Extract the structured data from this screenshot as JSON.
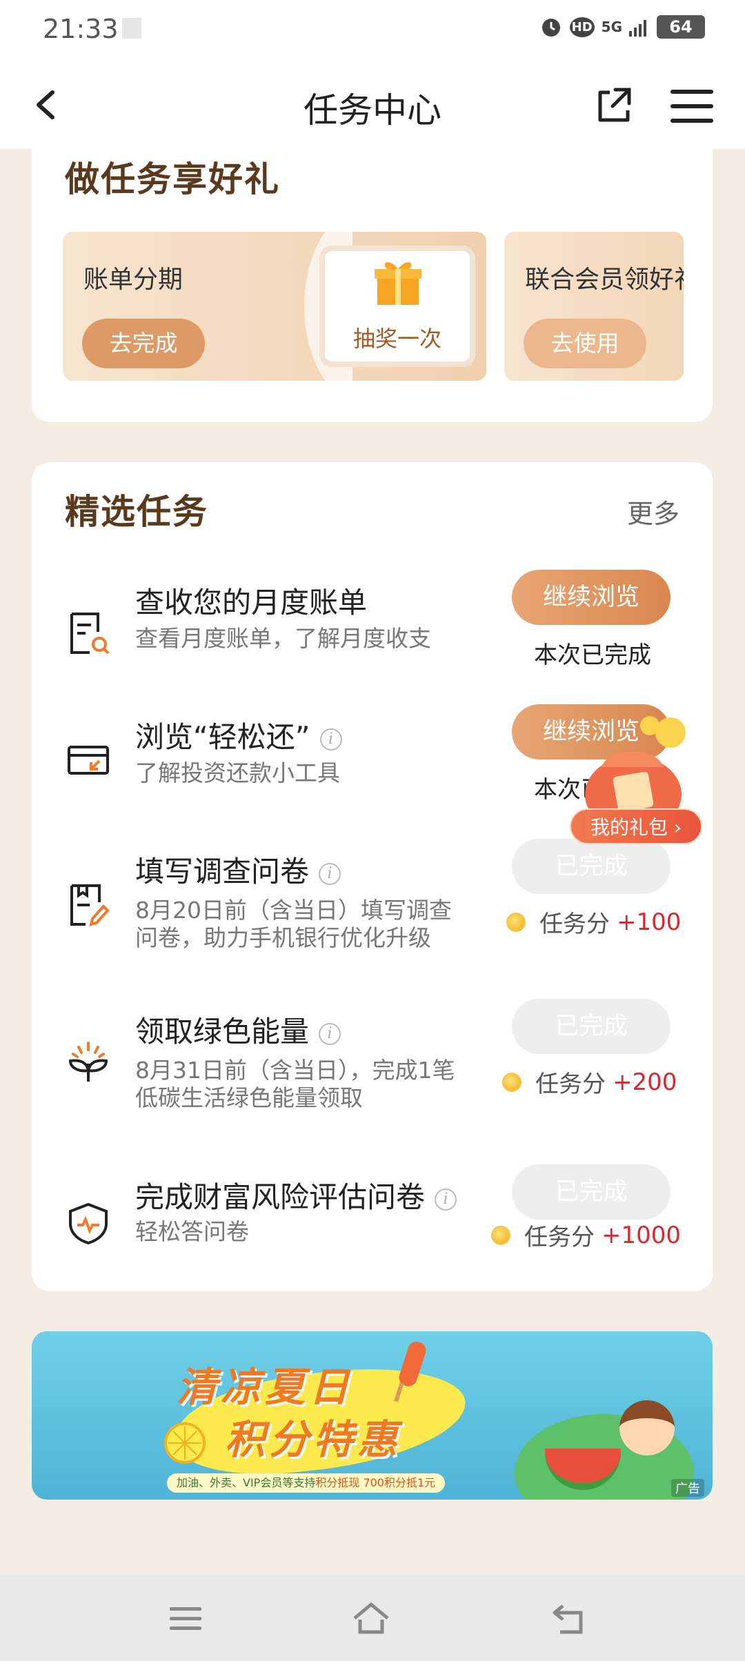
{
  "status_bar": {
    "time": "21:33",
    "battery": "64",
    "hd": "HD",
    "network": "5G"
  },
  "nav": {
    "title": "任务中心"
  },
  "gift_section": {
    "title": "做任务享好礼",
    "tiles": [
      {
        "name": "账单分期",
        "button": "去完成",
        "prize": "抽奖一次"
      },
      {
        "name": "联合会员领好礼",
        "button": "去使用"
      }
    ]
  },
  "featured": {
    "title": "精选任务",
    "more": "更多",
    "tasks": [
      {
        "title": "查收您的月度账单",
        "desc": "查看月度账单，了解月度收支",
        "button": "继续浏览",
        "status": "本次已完成",
        "icon": "bill-search-icon"
      },
      {
        "title": "浏览“轻松还”",
        "desc": "了解投资还款小工具",
        "button": "继续浏览",
        "status": "本次已完成",
        "icon": "card-cursor-icon"
      },
      {
        "title": "填写调查问卷",
        "desc": "8月20日前（含当日）填写调查问卷，助力手机银行优化升级",
        "button": "已完成",
        "reward_label": "任务分",
        "reward_value": "+100",
        "icon": "survey-pen-icon"
      },
      {
        "title": "领取绿色能量",
        "desc": "8月31日前（含当日），完成1笔低碳生活绿色能量领取",
        "button": "已完成",
        "reward_label": "任务分",
        "reward_value": "+200",
        "icon": "sprout-icon"
      },
      {
        "title": "完成财富风险评估问卷",
        "desc": "轻松答问卷",
        "button": "已完成",
        "reward_label": "任务分",
        "reward_value": "+1000",
        "icon": "shield-pulse-icon"
      }
    ],
    "info_glyph": "i"
  },
  "floating_gift": {
    "label": "我的礼包 ›"
  },
  "banner": {
    "title_line1": "清凉夏日",
    "title_line2": "积分特惠",
    "sub_prefix": "加油、外卖、VIP会员等支持",
    "sub_highlight1": "积分抵现",
    "sub_highlight2": "700积分抵1元",
    "ad_label": "广告"
  },
  "colors": {
    "accent": "#dd9a67",
    "reward": "#d9272e",
    "bg": "#f5ece3"
  }
}
